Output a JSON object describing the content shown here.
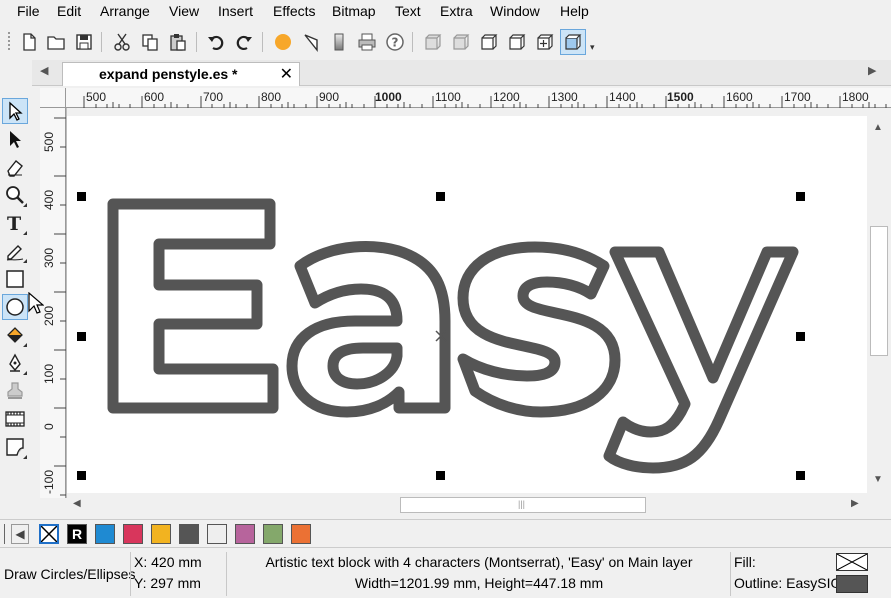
{
  "menu": [
    "File",
    "Edit",
    "Arrange",
    "View",
    "Insert",
    "Effects",
    "Bitmap",
    "Text",
    "Extra",
    "Window",
    "Help"
  ],
  "toolbar_icons": [
    "new-document-icon",
    "open-folder-icon",
    "save-icon",
    "cut-icon",
    "copy-icon",
    "paste-icon",
    "undo-icon",
    "redo-icon",
    "fill-color-icon",
    "outline-icon",
    "gradient-icon",
    "print-icon",
    "help-icon",
    "cube-view-1-icon",
    "cube-view-2-icon",
    "cube-view-3-icon",
    "cube-view-4-icon",
    "cube-view-5-icon",
    "cube-view-6-icon"
  ],
  "tab": {
    "title": "expand penstyle.es *",
    "close": "✕"
  },
  "ruler_h": [
    "500",
    "600",
    "700",
    "800",
    "900",
    "1000",
    "1100",
    "1200",
    "1300",
    "1400",
    "1500",
    "1600",
    "1700",
    "1800"
  ],
  "ruler_v": [
    "500",
    "400",
    "300",
    "200",
    "100",
    "0",
    "-100"
  ],
  "tools": [
    "select-arrow-icon",
    "node-edit-icon",
    "eraser-icon",
    "zoom-icon",
    "text-tool-icon",
    "pen-tool-icon",
    "rectangle-tool-icon",
    "ellipse-tool-icon",
    "fill-bucket-icon",
    "pen-nib-icon",
    "stamp-icon",
    "film-strip-icon",
    "page-curl-icon"
  ],
  "canvas": {
    "text": "Easy",
    "outline_color": "#555555"
  },
  "palette_colors": [
    "#1f8ad2",
    "#d8365c",
    "#f2b320",
    "#555555",
    "#eeeeee",
    "#b7649c",
    "#84a86b",
    "#eb7134"
  ],
  "palette_registration_label": "R",
  "status": {
    "tool_hint": "Draw Circles/Ellipses",
    "x": "X: 420 mm",
    "y": "Y: 297 mm",
    "info_line1": "Artistic text block with 4 characters (Montserrat), 'Easy' on Main layer",
    "info_line2": "Width=1201.99 mm, Height=447.18 mm",
    "fill_label": "Fill:",
    "outline_label": "Outline: EasySIG",
    "outline_color": "#555555"
  },
  "colors": {
    "accent": "#6aa7dc",
    "selection_bg": "#cce4f7"
  }
}
